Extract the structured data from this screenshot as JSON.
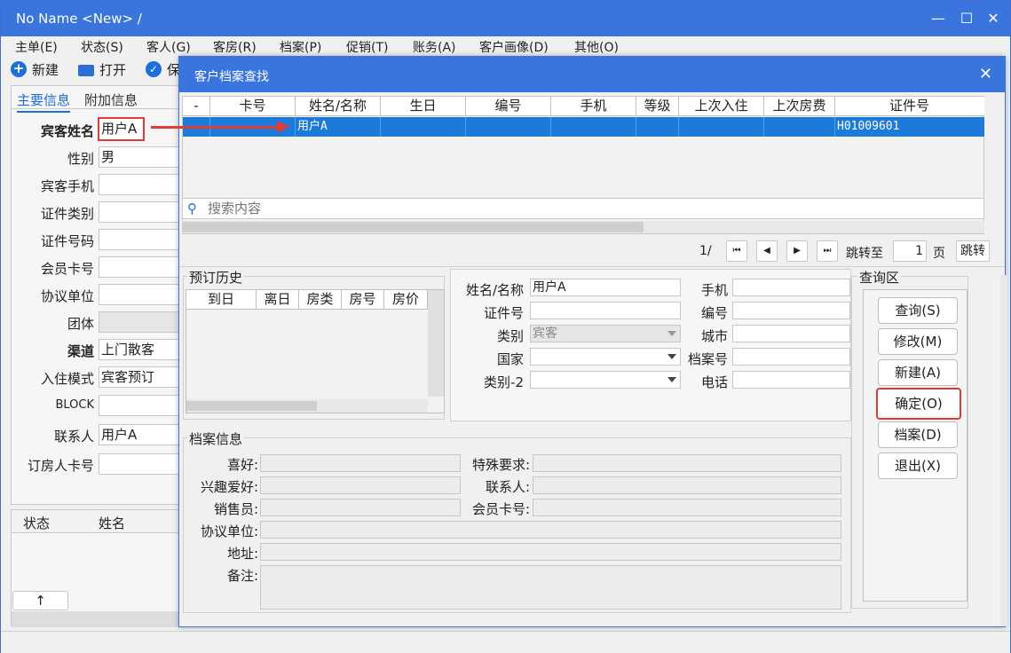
{
  "window": {
    "title": "No Name <New> /",
    "minimize": "—",
    "maximize": "☐",
    "close": "✕"
  },
  "menu": [
    "主单(E)",
    "状态(S)",
    "客人(G)",
    "客房(R)",
    "档案(P)",
    "促销(T)",
    "账务(A)",
    "客户画像(D)",
    "其他(O)"
  ],
  "toolbar": {
    "new": "新建",
    "open": "打开",
    "save": "保"
  },
  "left_panel": {
    "tabs": [
      "主要信息",
      "附加信息"
    ],
    "fields": [
      {
        "label": "宾客姓名",
        "value": "用户A",
        "bold": true
      },
      {
        "label": "性别",
        "value": "男"
      },
      {
        "label": "宾客手机",
        "value": ""
      },
      {
        "label": "证件类别",
        "value": ""
      },
      {
        "label": "证件号码",
        "value": ""
      },
      {
        "label": "会员卡号",
        "value": ""
      },
      {
        "label": "协议单位",
        "value": ""
      },
      {
        "label": "团体",
        "value": ""
      },
      {
        "label": "渠道",
        "value": "上门散客",
        "bold": true
      },
      {
        "label": "入住模式",
        "value": "宾客预订"
      },
      {
        "label": "BLOCK",
        "value": ""
      },
      {
        "label": "联系人",
        "value": "用户A"
      },
      {
        "label": "订房人卡号",
        "value": ""
      }
    ],
    "bottom_headers": [
      "状态",
      "姓名"
    ],
    "up_button": "↑"
  },
  "dialog": {
    "title": "客户档案查找",
    "close": "✕",
    "grid_headers": [
      "-",
      "卡号",
      "姓名/名称",
      "生日",
      "编号",
      "手机",
      "等级",
      "上次入住",
      "上次房费",
      "证件号"
    ],
    "grid_rows": [
      {
        "name": "用户A",
        "id_no": "H01009601"
      }
    ],
    "search_placeholder": "搜索内容",
    "pager": {
      "page": "1/",
      "first": "⏮",
      "prev": "◀",
      "next": "▶",
      "last": "⏭",
      "jump_label": "跳转至",
      "jump_value": "1",
      "page_label": "页",
      "jump_button": "跳转"
    },
    "history": {
      "title": "预订历史",
      "headers": [
        "到日",
        "离日",
        "房类",
        "房号",
        "房价"
      ]
    },
    "query": {
      "name_label": "姓名/名称",
      "name_value": "用户A",
      "id_label": "证件号",
      "type_label": "类别",
      "type_value": "宾客",
      "country_label": "国家",
      "type2_label": "类别-2",
      "mobile_label": "手机",
      "code_label": "编号",
      "city_label": "城市",
      "profile_no_label": "档案号",
      "phone_label": "电话"
    },
    "query_area": {
      "title": "查询区",
      "buttons": [
        "查询(S)",
        "修改(M)",
        "新建(A)",
        "确定(O)",
        "档案(D)",
        "退出(X)"
      ]
    },
    "profile": {
      "title": "档案信息",
      "hobby": "喜好:",
      "special": "特殊要求:",
      "interest": "兴趣爱好:",
      "contact": "联系人:",
      "sales": "销售员:",
      "member_card": "会员卡号:",
      "company": "协议单位:",
      "address": "地址:",
      "remark": "备注:"
    }
  },
  "colors": {
    "titlebar": "#3975dc",
    "selection": "#1c7ad9",
    "highlight": "#e53935"
  }
}
